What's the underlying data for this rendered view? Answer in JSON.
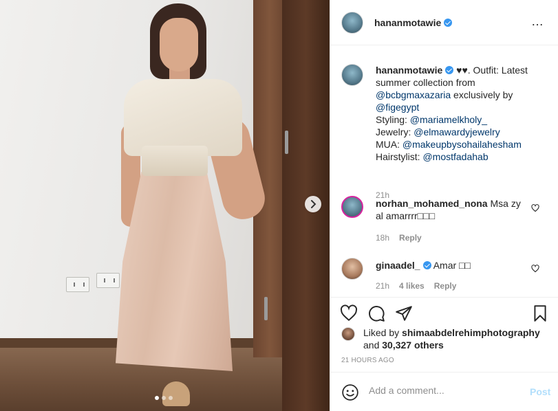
{
  "post": {
    "username": "hananmotawie",
    "more_icon": "…",
    "media": {
      "slide_count": 3,
      "active_slide": 0
    }
  },
  "caption": {
    "username": "hananmotawie",
    "hearts": "♥♥.",
    "text_outfit": " Outfit: Latest summer collection from ",
    "mention_brand": "@bcbgmaxazaria",
    "text_exclusive": " exclusively by ",
    "mention_store": "@figegypt",
    "styling_label": "Styling: ",
    "mention_styling": "@mariamelkholy_",
    "jewelry_label": "Jewelry: ",
    "mention_jewelry": "@elmawardyjewelry",
    "mua_label": "MUA: ",
    "mention_mua": "@makeupbysohailahesham",
    "hair_label": "Hairstylist: ",
    "mention_hair": "@mostfadahab",
    "time": "21h"
  },
  "comments": [
    {
      "username": "norhan_mohamed_nona",
      "text": " Msa zy al amarrrr□□□",
      "time": "18h",
      "reply": "Reply"
    },
    {
      "username": "ginaadel_",
      "text": " Amar □□",
      "time": "21h",
      "likes": "4 likes",
      "reply": "Reply"
    }
  ],
  "likes": {
    "prefix": "Liked by ",
    "liker": "shimaabdelrehimphotography",
    "and": "and ",
    "count": "30,327 others"
  },
  "timestamp": "21 HOURS AGO",
  "add_comment": {
    "placeholder": "Add a comment...",
    "post_label": "Post"
  },
  "colors": {
    "link": "#00376b",
    "verified": "#3897f0",
    "post_disabled": "#b2dffc",
    "meta": "#8e8e8e"
  },
  "icons": [
    "heart-icon",
    "comment-icon",
    "share-icon",
    "bookmark-icon",
    "emoji-icon",
    "chevron-right-icon",
    "verified-badge-icon",
    "more-options-icon"
  ]
}
